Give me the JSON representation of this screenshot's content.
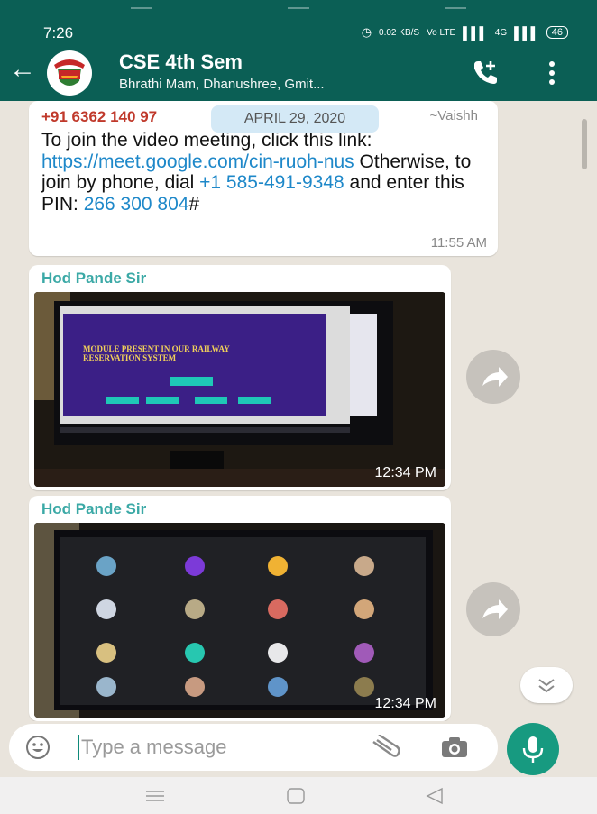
{
  "status": {
    "time": "7:26",
    "net_speed": "0.02 KB/S",
    "lte": "Vo LTE",
    "network": "4G",
    "battery": "46"
  },
  "chat": {
    "title": "CSE 4th Sem",
    "subtitle": "Bhrathi Mam, Dhanushree, Gmit..."
  },
  "date_pill": "APRIL 29, 2020",
  "message1": {
    "sender": "+91 6362 140 97",
    "alias": "~Vaishh",
    "line1": "To join the video meeting, click this link:",
    "link1": "https://meet.google.com/cin-ruoh-nus",
    "line2": "Otherwise, to join by phone, dial",
    "phone": "+1 585-491-9348",
    "line3": "and enter this PIN:",
    "pin": "266 300 804",
    "pin_suffix": "#",
    "time": "11:55 AM"
  },
  "message2": {
    "sender": "Hod Pande Sir",
    "time": "12:34 PM",
    "slide_title": "MODULE PRESENT IN OUR RAILWAY RESERVATION SYSTEM"
  },
  "message3": {
    "sender": "Hod Pande Sir",
    "time": "12:34 PM"
  },
  "input": {
    "placeholder": "Type a message"
  },
  "colors": {
    "header": "#0b5f55",
    "accent": "#179a80",
    "link": "#1e88c9",
    "sender_red": "#c0392b",
    "sender_teal": "#3ba9a6"
  }
}
